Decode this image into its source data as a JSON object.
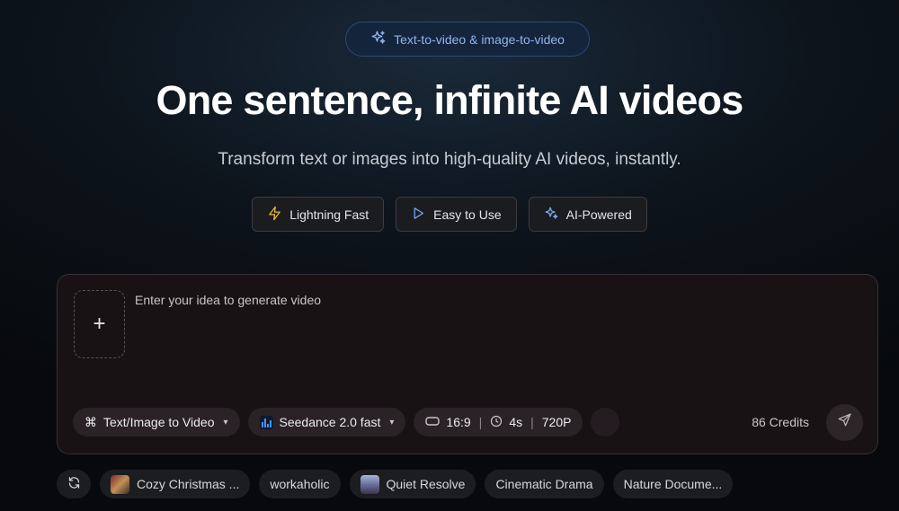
{
  "badge": {
    "label": "Text-to-video & image-to-video",
    "icon": "sparkles-icon"
  },
  "hero": {
    "title": "One sentence, infinite AI videos",
    "subtitle": "Transform text or images into high-quality AI videos, instantly."
  },
  "features": [
    {
      "label": "Lightning Fast",
      "icon": "lightning-icon",
      "color": "#f0b43a"
    },
    {
      "label": "Easy to Use",
      "icon": "play-icon",
      "color": "#7aa7ee"
    },
    {
      "label": "AI-Powered",
      "icon": "sparkles-icon",
      "color": "#7aa7ee"
    }
  ],
  "composer": {
    "placeholder": "Enter your idea to generate video",
    "upload_symbol": "+",
    "mode": {
      "symbol": "⌘",
      "label": "Text/Image to Video"
    },
    "model": {
      "label": "Seedance 2.0 fast"
    },
    "settings": {
      "aspect": "16:9",
      "duration": "4s",
      "resolution": "720P",
      "separator": "|"
    },
    "credits": "86 Credits"
  },
  "suggestions": [
    {
      "label": "Cozy Christmas ...",
      "thumb": "xmas"
    },
    {
      "label": "workaholic"
    },
    {
      "label": "Quiet Resolve",
      "thumb": "resolve"
    },
    {
      "label": "Cinematic Drama"
    },
    {
      "label": "Nature Docume..."
    }
  ]
}
